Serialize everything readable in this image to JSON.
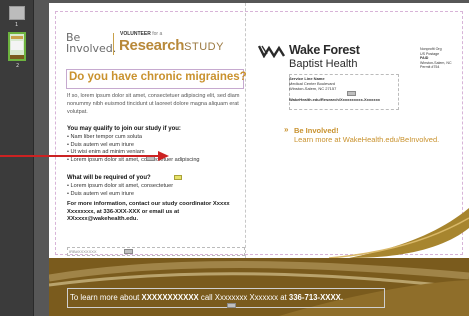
{
  "pages": {
    "top_number": "1",
    "selected_number": "2"
  },
  "logo": {
    "be": "Be",
    "involved": "Involved.",
    "volunteer": "VOLUNTEER",
    "for_a": "for a",
    "research": "Research",
    "study": "STUDY"
  },
  "headline": "Do you have chronic migraines?",
  "intro": "If so, lorem ipsum dolor sit amet, consectetuer adipiscing elit, sed diam nonummy nibh euismod tincidunt ut laoreet dolore magna aliquam erat volutpat.",
  "qualify": {
    "heading": "You may qualify to join our study if you:",
    "items": [
      "Nam liber tempor cum soluta",
      "Duis autem vel eum iriure",
      "Ut wisi enim ad minim veniam",
      "Lorem ipsum dolor sit amet, consectetuer adipiscing"
    ]
  },
  "required": {
    "heading": "What will be required of you?",
    "items": [
      "Lorem ipsum dolor sit amet, consectetuer",
      "Duis autem vel eum iriure"
    ]
  },
  "contact": "For more information, contact our study coordinator Xxxxx Xxxxxxxx, at 336-XXX-XXX or email us at XXxxxx@wakehealth.edu.",
  "small_box_text": "IRB#XXXXXXX",
  "right": {
    "brand_name": "Wake Forest",
    "brand_sub": "Baptist Health",
    "postage_lines": [
      "Nonprofit Org",
      "US Postage",
      "PAID",
      "Winston-Salem, NC",
      "Permit #754"
    ],
    "return_lines": [
      "Service Line Name",
      "Medical Center Boulevard",
      "Winston-Salem, NC 27157",
      "",
      "WakeHealth.edu/Research/Xxxxxxxxxx-Xxxxxxx"
    ],
    "be_involved": "Be Involved!",
    "learn_more": "Learn more at WakeHealth.edu/BeInvolved."
  },
  "band": {
    "prefix": "To learn more about",
    "study_name": "XXXXXXXXXXX",
    "mid": "call Xxxxxxxx Xxxxxxx at",
    "phone": "336-713-XXXX."
  },
  "colors": {
    "gold": "#c9922e",
    "brown_band": "#7a5b1d",
    "app_bg": "#575757",
    "selection_green": "#6db33f",
    "annotation_red": "#cc2222"
  }
}
